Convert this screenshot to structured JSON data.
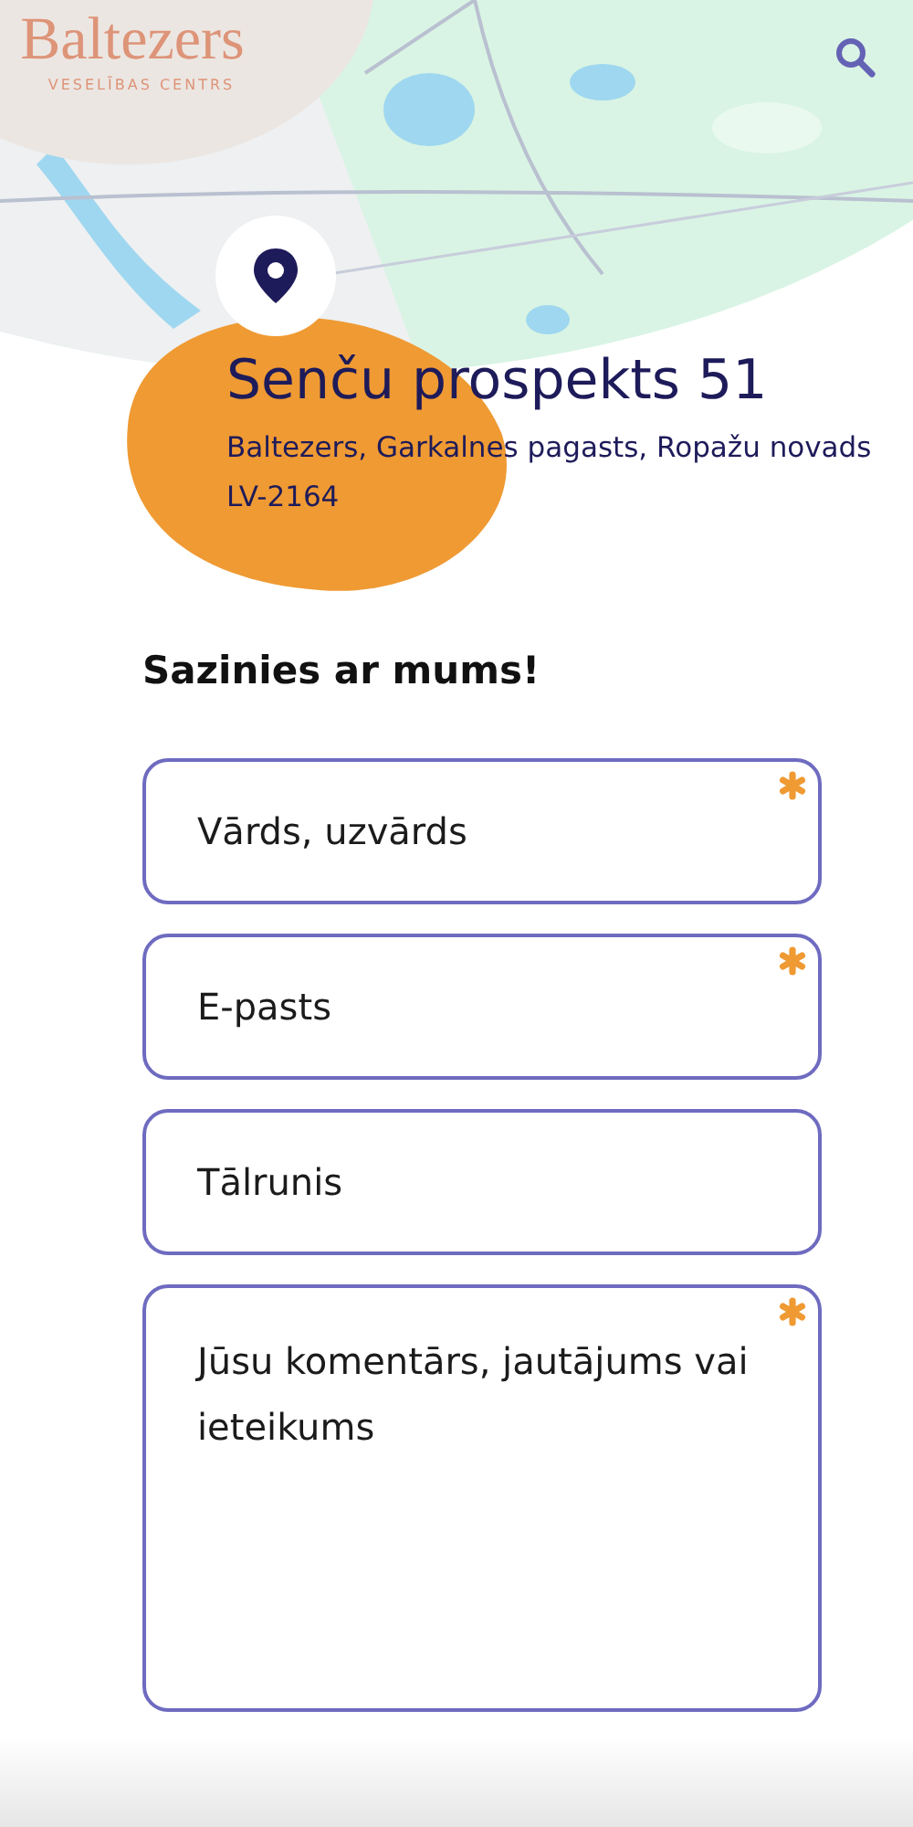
{
  "logo": {
    "name": "Baltezers",
    "subtitle": "VESELĪBAS CENTRS"
  },
  "address": {
    "street": "Senču prospekts 51",
    "locality": "Baltezers, Garkalnes pagasts, Ropažu novads",
    "postcode": "LV-2164"
  },
  "contact": {
    "heading": "Sazinies ar mums!",
    "fields": [
      {
        "kind": "input",
        "placeholder": "Vārds, uzvārds",
        "required": true
      },
      {
        "kind": "input",
        "placeholder": "E-pasts",
        "required": true
      },
      {
        "kind": "input",
        "placeholder": "Tālrunis",
        "required": false
      },
      {
        "kind": "textarea",
        "placeholder": "Jūsu komentārs, jautājums vai ieteikums",
        "required": true
      }
    ]
  }
}
